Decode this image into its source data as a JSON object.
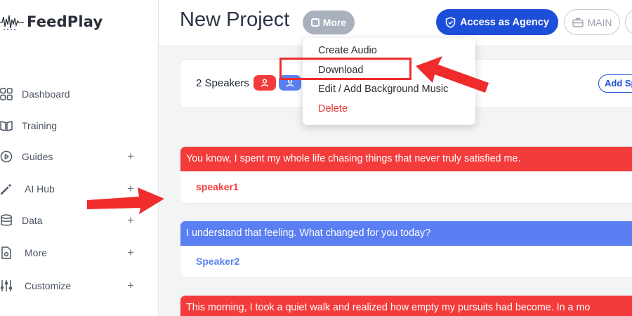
{
  "app": {
    "name": "FeedPlay"
  },
  "sidebar": {
    "items": [
      {
        "label": "Dashboard",
        "icon": "dashboard-grid-icon",
        "expandable": false
      },
      {
        "label": "Training",
        "icon": "book-open-icon",
        "expandable": false
      },
      {
        "label": "Guides",
        "icon": "play-circle-icon",
        "expandable": true
      },
      {
        "label": "AI Hub",
        "icon": "magic-wand-icon",
        "expandable": true
      },
      {
        "label": "Data",
        "icon": "database-icon",
        "expandable": true
      },
      {
        "label": "More",
        "icon": "document-gear-icon",
        "expandable": true
      },
      {
        "label": "Customize",
        "icon": "sliders-icon",
        "expandable": true
      }
    ],
    "expand_glyph": "+"
  },
  "header": {
    "title": "New Project",
    "more_label": "More",
    "agency_label": "Access as Agency",
    "main_label": "MAIN"
  },
  "speakers": {
    "label": "2 Speakers",
    "add_label": "Add Sp"
  },
  "dropdown": {
    "items": [
      {
        "label": "Create Audio",
        "danger": false
      },
      {
        "label": "Download",
        "danger": false,
        "highlighted": true
      },
      {
        "label": "Edit / Add Background Music",
        "danger": false
      },
      {
        "label": "Delete",
        "danger": true
      }
    ]
  },
  "script": [
    {
      "text": "You know, I spent my whole life chasing things that never truly satisfied me.",
      "speaker": "speaker1",
      "color": "#f43b3b"
    },
    {
      "text": "I understand that feeling. What changed for you today?",
      "speaker": "Speaker2",
      "color": "#5b7ff2"
    },
    {
      "text": "This morning, I took a quiet walk and realized how empty my pursuits had become. In a mo",
      "speaker": "",
      "color": "#f43b3b"
    }
  ],
  "colors": {
    "brand_blue": "#1d4ed8",
    "speaker1": "#f43b3b",
    "speaker2": "#5b7ff2",
    "annotation_red": "#ef2b2b"
  }
}
